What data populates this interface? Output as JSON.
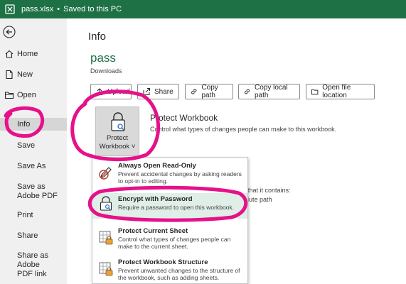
{
  "titlebar": {
    "file_name": "pass.xlsx",
    "separator": "•",
    "save_status": "Saved to this PC"
  },
  "sidebar": {
    "items": [
      {
        "label": "Home",
        "icon": "home-icon"
      },
      {
        "label": "New",
        "icon": "new-file-icon"
      },
      {
        "label": "Open",
        "icon": "folder-icon"
      },
      {
        "label": "Info"
      },
      {
        "label": "Save"
      },
      {
        "label": "Save As"
      },
      {
        "label": "Save as Adobe PDF"
      },
      {
        "label": "Print"
      },
      {
        "label": "Share"
      },
      {
        "label": "Share as Adobe PDF link"
      }
    ]
  },
  "main": {
    "title": "Info",
    "file_name": "pass",
    "file_location": "Downloads",
    "actions": [
      "Upload",
      "Share",
      "Copy path",
      "Copy local path",
      "Open file location"
    ]
  },
  "protect": {
    "tile_line1": "Protect",
    "tile_line2": "Workbook",
    "tile_chevron": "˅",
    "title": "Protect Workbook",
    "description": "Control what types of changes people can make to this workbook."
  },
  "background_text": {
    "line1": "that it contains:",
    "line2": "lute path"
  },
  "menu": {
    "items": [
      {
        "title": "Always Open Read-Only",
        "description": "Prevent accidental changes by asking readers to opt-in to editing."
      },
      {
        "title": "Encrypt with Password",
        "description": "Require a password to open this workbook."
      },
      {
        "title": "Protect Current Sheet",
        "description": "Control what types of changes people can make to the current sheet."
      },
      {
        "title": "Protect Workbook Structure",
        "description": "Prevent unwanted changes to the structure of the workbook, such as adding sheets."
      }
    ]
  },
  "colors": {
    "title_bar": "#1e7145",
    "sidebar_bg": "#f0f0f0",
    "active_nav": "#d6d6d6",
    "annotation": "#e6118a"
  }
}
